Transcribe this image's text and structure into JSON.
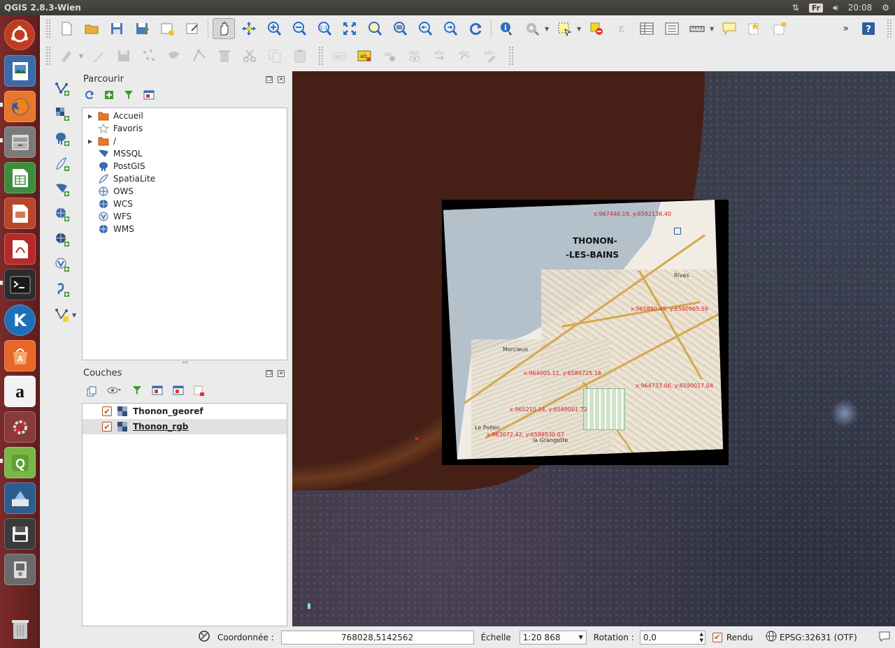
{
  "top_panel": {
    "app_title": "QGIS 2.8.3-Wien",
    "keyboard_layout": "Fr",
    "clock": "20:08"
  },
  "launcher": {
    "items": [
      "ubuntu-dash",
      "files",
      "firefox",
      "file-manager",
      "libreoffice-calc",
      "libreoffice-impress",
      "document-viewer",
      "terminal",
      "kde-app",
      "software-center",
      "amazon",
      "system-settings",
      "qgis",
      "qgis-browser",
      "disk-save",
      "media-player",
      "trash"
    ]
  },
  "browser_panel": {
    "title": "Parcourir",
    "items": [
      {
        "label": "Accueil",
        "has_arrow": true,
        "icon": "folder-icon"
      },
      {
        "label": "Favoris",
        "has_arrow": false,
        "icon": "star-icon"
      },
      {
        "label": "/",
        "has_arrow": true,
        "icon": "folder-icon"
      },
      {
        "label": "MSSQL",
        "has_arrow": false,
        "icon": "mssql-icon"
      },
      {
        "label": "PostGIS",
        "has_arrow": false,
        "icon": "postgis-icon"
      },
      {
        "label": "SpatiaLite",
        "has_arrow": false,
        "icon": "spatialite-icon"
      },
      {
        "label": "OWS",
        "has_arrow": false,
        "icon": "ows-icon"
      },
      {
        "label": "WCS",
        "has_arrow": false,
        "icon": "wcs-icon"
      },
      {
        "label": "WFS",
        "has_arrow": false,
        "icon": "wfs-icon"
      },
      {
        "label": "WMS",
        "has_arrow": false,
        "icon": "wms-icon"
      }
    ]
  },
  "layers_panel": {
    "title": "Couches",
    "layers": [
      {
        "name": "Thonon_georef",
        "checked": true,
        "selected": false
      },
      {
        "name": "Thonon_rgb",
        "checked": true,
        "selected": true
      }
    ]
  },
  "map": {
    "georef_title_line1": "THONON-",
    "georef_title_line2": "-LES-BAINS",
    "labels": [
      "x:967440.19, y:6592136.40",
      "x:965890.45, y:6590965.56",
      "x:964005.12, y:6589725.16",
      "x:964733.06, y:6590017.04",
      "x:965210.14, y:6589001.72",
      "x:963072.42, y:6588530.07"
    ],
    "place_labels": [
      "Rives",
      "Morcieux",
      "Le Pollen",
      "la Grangette"
    ]
  },
  "status_bar": {
    "coord_label": "Coordonnée :",
    "coord_value": "768028,5142562",
    "scale_label": "Échelle",
    "scale_value": "1:20 868",
    "rotation_label": "Rotation :",
    "rotation_value": "0,0",
    "render_label": "Rendu",
    "render_checked": true,
    "crs": "EPSG:32631 (OTF)"
  }
}
